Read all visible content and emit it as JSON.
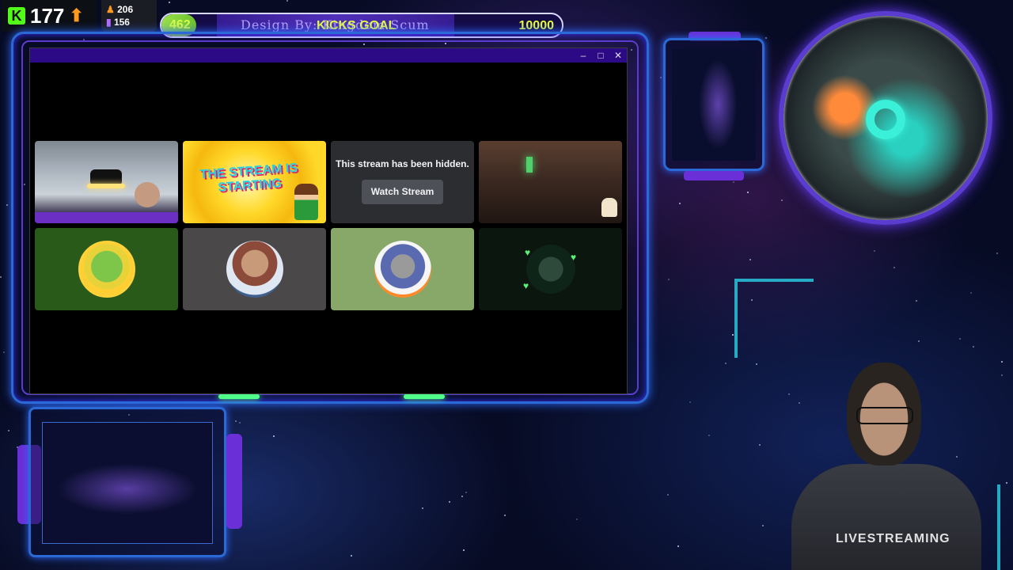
{
  "kick": {
    "logo": "K",
    "count": "177",
    "trend_icon": "arrow-up-icon"
  },
  "stats": {
    "followers_icon": "person-icon",
    "followers": "206",
    "views_icon": "bar-chart-icon",
    "views": "156"
  },
  "goal_bar": {
    "current": "462",
    "designer_text": "Design By: Kingdom Scum",
    "label": "KICKS GOAL",
    "target": "10000",
    "progress_fraction": 0.0462
  },
  "window": {
    "controls": [
      "–",
      "□",
      "✕"
    ]
  },
  "streams": {
    "hidden_message": "This stream has been hidden.",
    "watch_button": "Watch Stream",
    "starting_text": "THE STREAM IS STARTING"
  },
  "webcam": {
    "shirt_text": "LIVESTREAMING"
  },
  "colors": {
    "kick_green": "#53fc18",
    "accent_purple": "#2c0a86",
    "goal_text": "#e8ff3a",
    "frame_blue": "#2b6ad6"
  }
}
